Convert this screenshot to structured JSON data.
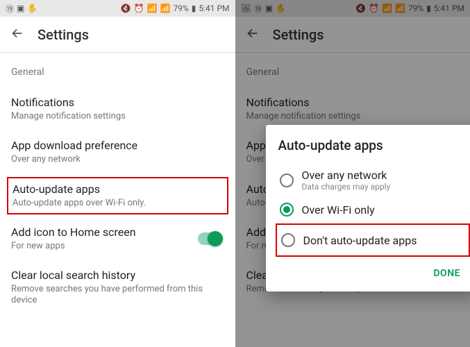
{
  "statusbar": {
    "battery": "79%",
    "time": "5:41 PM"
  },
  "appbar": {
    "title": "Settings"
  },
  "section": {
    "general": "General"
  },
  "settings": {
    "notifications": {
      "label": "Notifications",
      "sub": "Manage notification settings"
    },
    "download": {
      "label": "App download preference",
      "sub": "Over any network"
    },
    "autoupdate": {
      "label": "Auto-update apps",
      "sub": "Auto-update apps over Wi-Fi only."
    },
    "addicon": {
      "label": "Add icon to Home screen",
      "sub": "For new apps"
    },
    "clearhistory": {
      "label": "Clear local search history",
      "sub": "Remove searches you have performed from this device"
    }
  },
  "right": {
    "download_trunc": {
      "label": "App do",
      "sub": "Over a"
    },
    "autoupdate_trunc": {
      "label": "Auto-u",
      "sub": "Auto-u"
    },
    "addicon_trunc": {
      "label": "Add i",
      "sub": "For ne"
    },
    "clear_trunc": {
      "label": "Clear",
      "sub": "Remove searches you have performed from this"
    }
  },
  "dialog": {
    "title": "Auto-update apps",
    "options": {
      "any": {
        "label": "Over any network",
        "sub": "Data charges may apply"
      },
      "wifi": {
        "label": "Over Wi-Fi only"
      },
      "dont": {
        "label": "Don't auto-update apps"
      }
    },
    "done": "DONE"
  }
}
